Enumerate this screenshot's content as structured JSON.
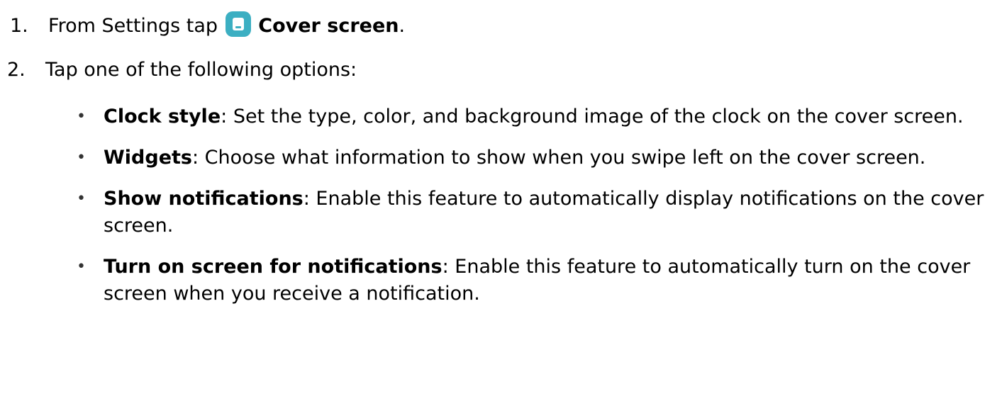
{
  "steps": [
    {
      "number": "1.",
      "text_before": "From Settings tap",
      "icon": "settings-cover-screen-icon",
      "target": "Cover screen",
      "trailing": "."
    },
    {
      "number": "2.",
      "text": "Tap one of the following options:"
    }
  ],
  "options": [
    {
      "term": "Clock style",
      "description": "Set the type, color, and background image of the clock on the cover screen."
    },
    {
      "term": "Widgets",
      "description": "Choose what information to show when you swipe left on the cover screen."
    },
    {
      "term": "Show notifications",
      "description": "Enable this feature to automatically display notifications on the cover screen."
    },
    {
      "term": "Turn on screen for notifications",
      "description": "Enable this feature to automatically turn on the cover screen when you receive a notification."
    }
  ],
  "colors": {
    "icon_background": "#3cafc2",
    "text": "#000000"
  }
}
